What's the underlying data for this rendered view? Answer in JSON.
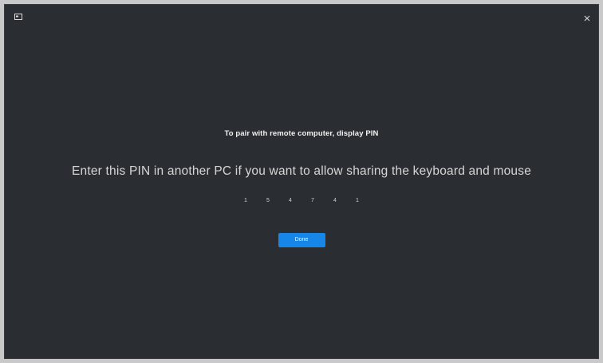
{
  "titlebar": {
    "app_icon": "app-window-icon",
    "close_icon": "close-icon"
  },
  "dialog": {
    "heading": "To pair with remote computer, display PIN",
    "instruction": "Enter this PIN in another PC if you want to allow sharing the keyboard and mouse",
    "pin_digits": [
      "1",
      "5",
      "4",
      "7",
      "4",
      "1"
    ],
    "done_label": "Done"
  },
  "colors": {
    "background": "#2a2d31",
    "accent": "#1687e8"
  }
}
